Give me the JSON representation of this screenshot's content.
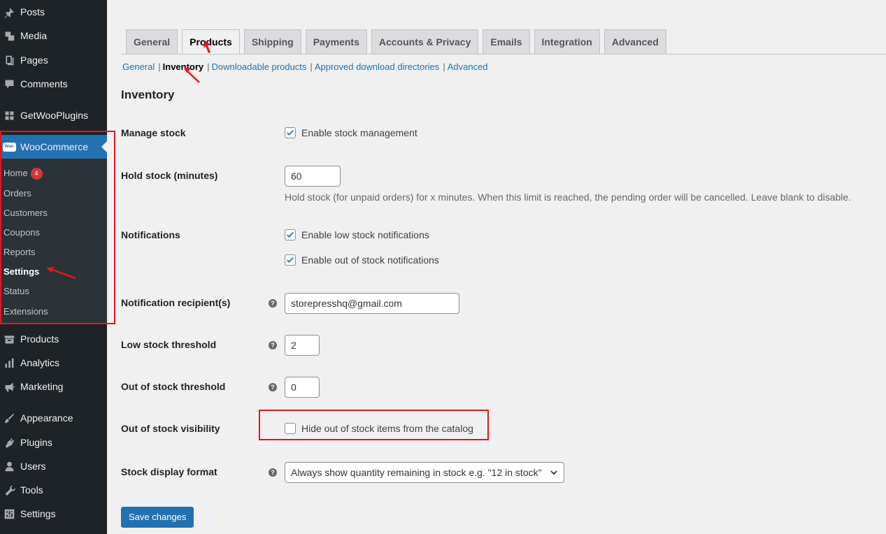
{
  "sidebar": {
    "top_items": [
      {
        "label": "Posts",
        "icon": "pin-icon"
      },
      {
        "label": "Media",
        "icon": "media-icon"
      },
      {
        "label": "Pages",
        "icon": "pages-icon"
      },
      {
        "label": "Comments",
        "icon": "comment-icon"
      },
      {
        "label": "GetWooPlugins",
        "icon": "grid-icon"
      }
    ],
    "woocommerce": {
      "label": "WooCommerce",
      "logo_text": "Woo"
    },
    "submenu": [
      {
        "label": "Home",
        "badge": "4"
      },
      {
        "label": "Orders"
      },
      {
        "label": "Customers"
      },
      {
        "label": "Coupons"
      },
      {
        "label": "Reports"
      },
      {
        "label": "Settings"
      },
      {
        "label": "Status"
      },
      {
        "label": "Extensions"
      }
    ],
    "bottom_items": [
      {
        "label": "Products",
        "icon": "archive-icon"
      },
      {
        "label": "Analytics",
        "icon": "bar-chart-icon"
      },
      {
        "label": "Marketing",
        "icon": "megaphone-icon"
      },
      {
        "label": "Appearance",
        "icon": "paintbrush-icon"
      },
      {
        "label": "Plugins",
        "icon": "plugin-icon"
      },
      {
        "label": "Users",
        "icon": "user-icon"
      },
      {
        "label": "Tools",
        "icon": "wrench-icon"
      },
      {
        "label": "Settings",
        "icon": "sliders-icon"
      }
    ]
  },
  "tabs": [
    "General",
    "Products",
    "Shipping",
    "Payments",
    "Accounts & Privacy",
    "Emails",
    "Integration",
    "Advanced"
  ],
  "active_tab": "Products",
  "subsections": [
    "General",
    "Inventory",
    "Downloadable products",
    "Approved download directories",
    "Advanced"
  ],
  "active_subsection": "Inventory",
  "section_title": "Inventory",
  "fields": {
    "manage_stock": {
      "label": "Manage stock",
      "checkbox_label": "Enable stock management",
      "checked": true
    },
    "hold_stock": {
      "label": "Hold stock (minutes)",
      "value": "60",
      "description": "Hold stock (for unpaid orders) for x minutes. When this limit is reached, the pending order will be cancelled. Leave blank to disable."
    },
    "notifications": {
      "label": "Notifications",
      "low_stock_label": "Enable low stock notifications",
      "low_stock_checked": true,
      "out_of_stock_label": "Enable out of stock notifications",
      "out_of_stock_checked": true
    },
    "recipient": {
      "label": "Notification recipient(s)",
      "value": "storepresshq@gmail.com"
    },
    "low_threshold": {
      "label": "Low stock threshold",
      "value": "2"
    },
    "out_threshold": {
      "label": "Out of stock threshold",
      "value": "0"
    },
    "visibility": {
      "label": "Out of stock visibility",
      "checkbox_label": "Hide out of stock items from the catalog",
      "checked": false
    },
    "display_format": {
      "label": "Stock display format",
      "selected": "Always show quantity remaining in stock e.g. \"12 in stock\""
    }
  },
  "help_icon_glyph": "?",
  "save_label": "Save changes",
  "colors": {
    "accent": "#2271b1",
    "sidebar_bg": "#1d2327",
    "annotation_red": "#e0181b",
    "badge_red": "#d63638"
  }
}
